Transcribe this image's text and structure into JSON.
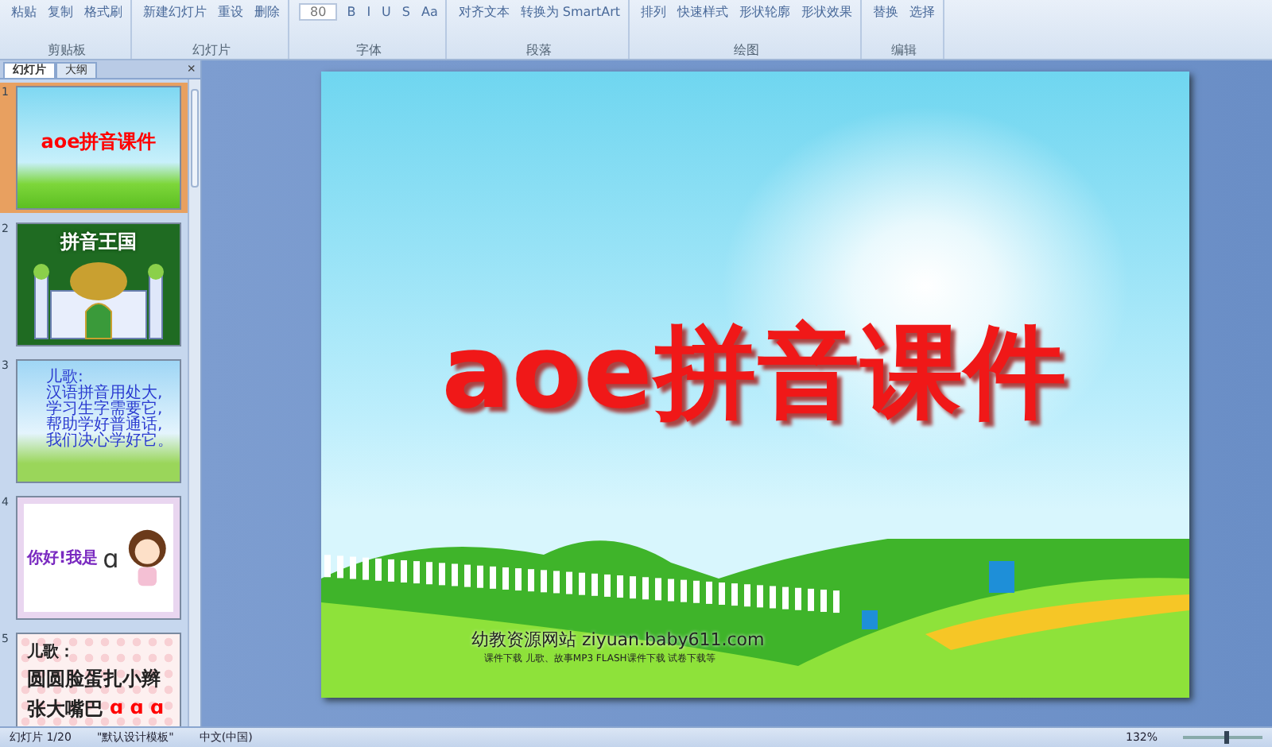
{
  "ribbon": {
    "groups": [
      {
        "label": "剪贴板",
        "buttons": [
          "粘贴",
          "复制",
          "格式刷"
        ]
      },
      {
        "label": "幻灯片",
        "buttons": [
          "新建幻灯片",
          "重设",
          "删除"
        ]
      },
      {
        "label": "字体",
        "font_size": "80",
        "buttons": [
          "B",
          "I",
          "U",
          "S",
          "Aa"
        ]
      },
      {
        "label": "段落",
        "buttons": [
          "对齐文本",
          "转换为 SmartArt"
        ]
      },
      {
        "label": "绘图",
        "buttons": [
          "排列",
          "快速样式",
          "形状轮廓",
          "形状效果"
        ]
      },
      {
        "label": "编辑",
        "buttons": [
          "替换",
          "选择"
        ]
      }
    ]
  },
  "pane": {
    "tabs": [
      {
        "label": "幻灯片",
        "selected": true
      },
      {
        "label": "大纲",
        "selected": false
      }
    ],
    "close": "×",
    "slides": [
      {
        "number": "1",
        "selected": true,
        "kind": "title",
        "lines": [
          "aoe拼音课件"
        ]
      },
      {
        "number": "2",
        "selected": false,
        "kind": "castle",
        "lines": [
          "拼音王国"
        ]
      },
      {
        "number": "3",
        "selected": false,
        "kind": "poem",
        "lines": [
          "儿歌:",
          "汉语拼音用处大,",
          "学习生字需要它,",
          "帮助学好普通话,",
          "我们决心学好它。"
        ]
      },
      {
        "number": "4",
        "selected": false,
        "kind": "greeting",
        "lines": [
          "你好!我是",
          "ɑ"
        ]
      },
      {
        "number": "5",
        "selected": false,
        "kind": "song",
        "lines": [
          "儿歌：",
          "圆圆脸蛋扎小辫",
          "张大嘴巴",
          "ɑ ɑ ɑ"
        ]
      }
    ]
  },
  "slide": {
    "title": "aoe拼音课件",
    "footer": "幼教资源网站  ziyuan.baby611.com",
    "footer_links": "课件下载  儿歌、故事MP3  FLASH课件下载  试卷下载等"
  },
  "status_bar": {
    "slide": "幻灯片 1/20",
    "theme": "\"默认设计模板\"",
    "language": "中文(中国)",
    "zoom": "132%",
    "zoom_slider": {
      "level": 0.55
    }
  }
}
